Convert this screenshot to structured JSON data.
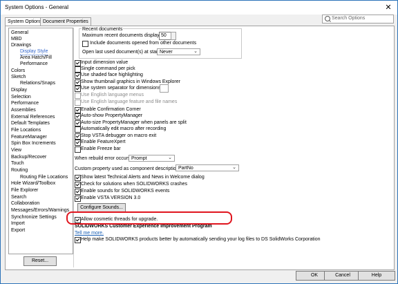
{
  "window": {
    "title": "System Options - General",
    "close": "✕"
  },
  "tabs": [
    "System Options",
    "Document Properties"
  ],
  "search": {
    "placeholder": "Search Options"
  },
  "tree": [
    "General",
    "MBD",
    "Drawings",
    "Display Style",
    "Area Hatch/Fill",
    "Performance",
    "Colors",
    "Sketch",
    "Relations/Snaps",
    "Display",
    "Selection",
    "Performance",
    "Assemblies",
    "External References",
    "Default Templates",
    "File Locations",
    "FeatureManager",
    "Spin Box Increments",
    "View",
    "Backup/Recover",
    "Touch",
    "Routing",
    "Routing File Locations",
    "Hole Wizard/Toolbox",
    "File Explorer",
    "Search",
    "Collaboration",
    "Messages/Errors/Warnings",
    "Synchronize Settings",
    "Import",
    "Export"
  ],
  "reset_label": "Reset...",
  "recent": {
    "group_title": "Recent documents",
    "max_label": "Maximum recent documents displayed:",
    "max_value": "50",
    "include_label": "Include documents opened from other documents",
    "open_last_label": "Open last used document(s) at startup:",
    "open_last_value": "Never"
  },
  "options": [
    {
      "label": "Input dimension value",
      "checked": true
    },
    {
      "label": "Single command per pick",
      "checked": false
    },
    {
      "label": "Use shaded face highlighting",
      "checked": true
    },
    {
      "label": "Show thumbnail graphics in Windows Explorer",
      "checked": true
    },
    {
      "label": "Use system separator for dimensions",
      "checked": true
    },
    {
      "label": "Use English language menus",
      "checked": false,
      "disabled": true
    },
    {
      "label": "Use English language feature and file names",
      "checked": false,
      "disabled": true
    },
    {
      "label": "Enable Confirmation Corner",
      "checked": true
    },
    {
      "label": "Auto-show PropertyManager",
      "checked": true
    },
    {
      "label": "Auto-size PropertyManager when panels are split",
      "checked": true
    },
    {
      "label": "Automatically edit macro after recording",
      "checked": false
    },
    {
      "label": "Stop VSTA debugger on macro exit",
      "checked": true
    },
    {
      "label": "Enable FeatureXpert",
      "checked": true
    },
    {
      "label": "Enable Freeze bar",
      "checked": false
    }
  ],
  "rebuild": {
    "label": "When rebuild error occurs:",
    "value": "Prompt"
  },
  "custom_prop": {
    "label": "Custom property used as component description:",
    "value": "PartNo"
  },
  "options2": [
    {
      "label": "Show latest Technical Alerts and News in Welcome dialog",
      "checked": true
    },
    {
      "label": "Check for solutions when SOLIDWORKS crashes",
      "checked": true
    },
    {
      "label": "Enable sounds for SOLIDWORKS events",
      "checked": true
    },
    {
      "label": "Enable VSTA VERSION 3.0",
      "checked": true
    }
  ],
  "configure_sounds": "Configure Sounds...",
  "cosmetic": {
    "label": "Allow cosmetic threads for upgrade.",
    "checked": true
  },
  "ceip": {
    "title": "SOLIDWORKS Customer Experience Improvement Program",
    "link": "Tell me more.",
    "label": "Help make SOLIDWORKS products better by automatically sending your log files to DS SolidWorks Corporation",
    "checked": true
  },
  "buttons": {
    "ok": "OK",
    "cancel": "Cancel",
    "help": "Help"
  },
  "colors": {
    "highlight": "#e0141d",
    "link": "#1a5fb4",
    "title_border": "#2b72b8"
  }
}
